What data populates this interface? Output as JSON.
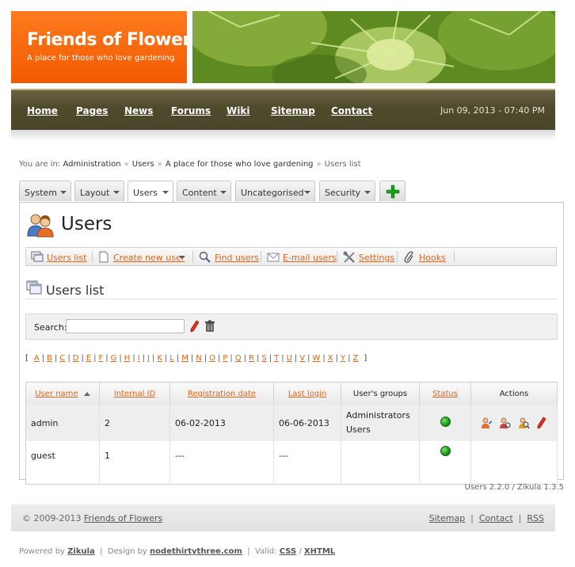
{
  "site": {
    "title": "Friends of Flowers",
    "slogan": "A place for those who love gardening"
  },
  "nav": {
    "items": [
      "Home",
      "Pages",
      "News",
      "Forums",
      "Wiki",
      "Sitemap",
      "Contact"
    ],
    "date": "Jun 09, 2013 - 07:40 PM"
  },
  "breadcrumb": {
    "prefix": "You are in:",
    "items": [
      "Administration",
      "Users",
      "A place for those who love gardening"
    ],
    "current": "Users list",
    "separator": "»"
  },
  "tabs": {
    "items": [
      "System",
      "Layout",
      "Users",
      "Content",
      "Uncategorised",
      "Security"
    ],
    "active": "Users",
    "add_icon": "plus-icon"
  },
  "page": {
    "title": "Users",
    "section_title": "Users list"
  },
  "toolbar": {
    "items": [
      "Users list",
      "Create new user",
      "Find users",
      "E-mail users",
      "Settings",
      "Hooks"
    ]
  },
  "search": {
    "label": "Search:",
    "value": ""
  },
  "letters": {
    "open": "[",
    "close": "]",
    "items": [
      "A",
      "B",
      "C",
      "D",
      "E",
      "F",
      "G",
      "H",
      "I",
      "J",
      "K",
      "L",
      "M",
      "N",
      "O",
      "P",
      "Q",
      "R",
      "S",
      "T",
      "U",
      "V",
      "W",
      "X",
      "Y",
      "Z"
    ]
  },
  "table": {
    "headers": [
      "User name",
      "Internal ID",
      "Registration date",
      "Last login",
      "User's groups",
      "Status",
      "Actions"
    ],
    "rows": [
      {
        "name": "admin",
        "id": "2",
        "registered": "06-02-2013",
        "last_login": "06-06-2013",
        "groups_1": "Administrators",
        "groups_2": "Users",
        "status": "active"
      },
      {
        "name": "guest",
        "id": "1",
        "registered": "---",
        "last_login": "---",
        "groups_1": "",
        "groups_2": "",
        "status": "active"
      }
    ]
  },
  "version": "Users 2.2.0 / Zikula 1.3.5",
  "footer": {
    "copyright_prefix": "© 2009-2013",
    "copyright_link": "Friends of Flowers",
    "links": [
      "Sitemap",
      "Contact",
      "RSS"
    ],
    "powered_prefix": "Powered by",
    "powered_link": "Zikula",
    "design_prefix": "Design by",
    "design_link": "nodethirtythree.com",
    "valid_prefix": "Valid:",
    "valid_links": [
      "CSS",
      "XHTML"
    ]
  },
  "colors": {
    "brand_orange": "#f25a00",
    "nav_bg": "#4f4a2c",
    "link_orange": "#e0651a",
    "status_green": "#0c8a12"
  }
}
